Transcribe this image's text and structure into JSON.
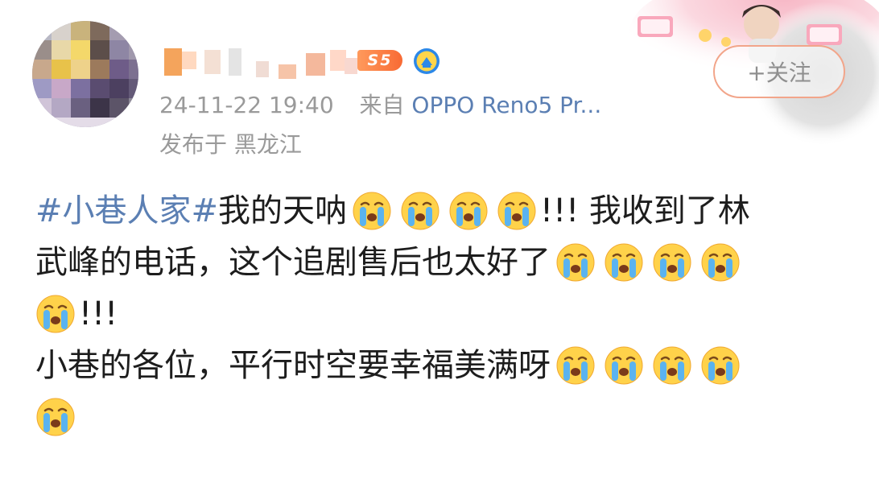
{
  "post": {
    "author": {
      "name": "",
      "level_badge": "S5",
      "verified": true
    },
    "timestamp": "24-11-22 19:40",
    "source_prefix": "来自",
    "device": "OPPO Reno5 Pr...",
    "location": "发布于 黑龙江",
    "follow_label": "+关注",
    "content": {
      "hashtag": "#小巷人家#",
      "line1_text_a": "我的天呐",
      "line1_text_b": "!!! 我收到了林",
      "line2_text": "武峰的电话，这个追剧售后也太好了",
      "line3_text": "!!!",
      "line4_text": "小巷的各位，平行时空要幸福美满呀",
      "emoji_name": "crying-face-emoji"
    }
  },
  "colors": {
    "link_blue": "#5b7fb3",
    "meta_gray": "#9a9a9a",
    "text": "#1d1d1d",
    "badge_orange": "#f86a34",
    "emoji_yellow": "#ffd24a",
    "tear_blue": "#5ab3f0"
  }
}
